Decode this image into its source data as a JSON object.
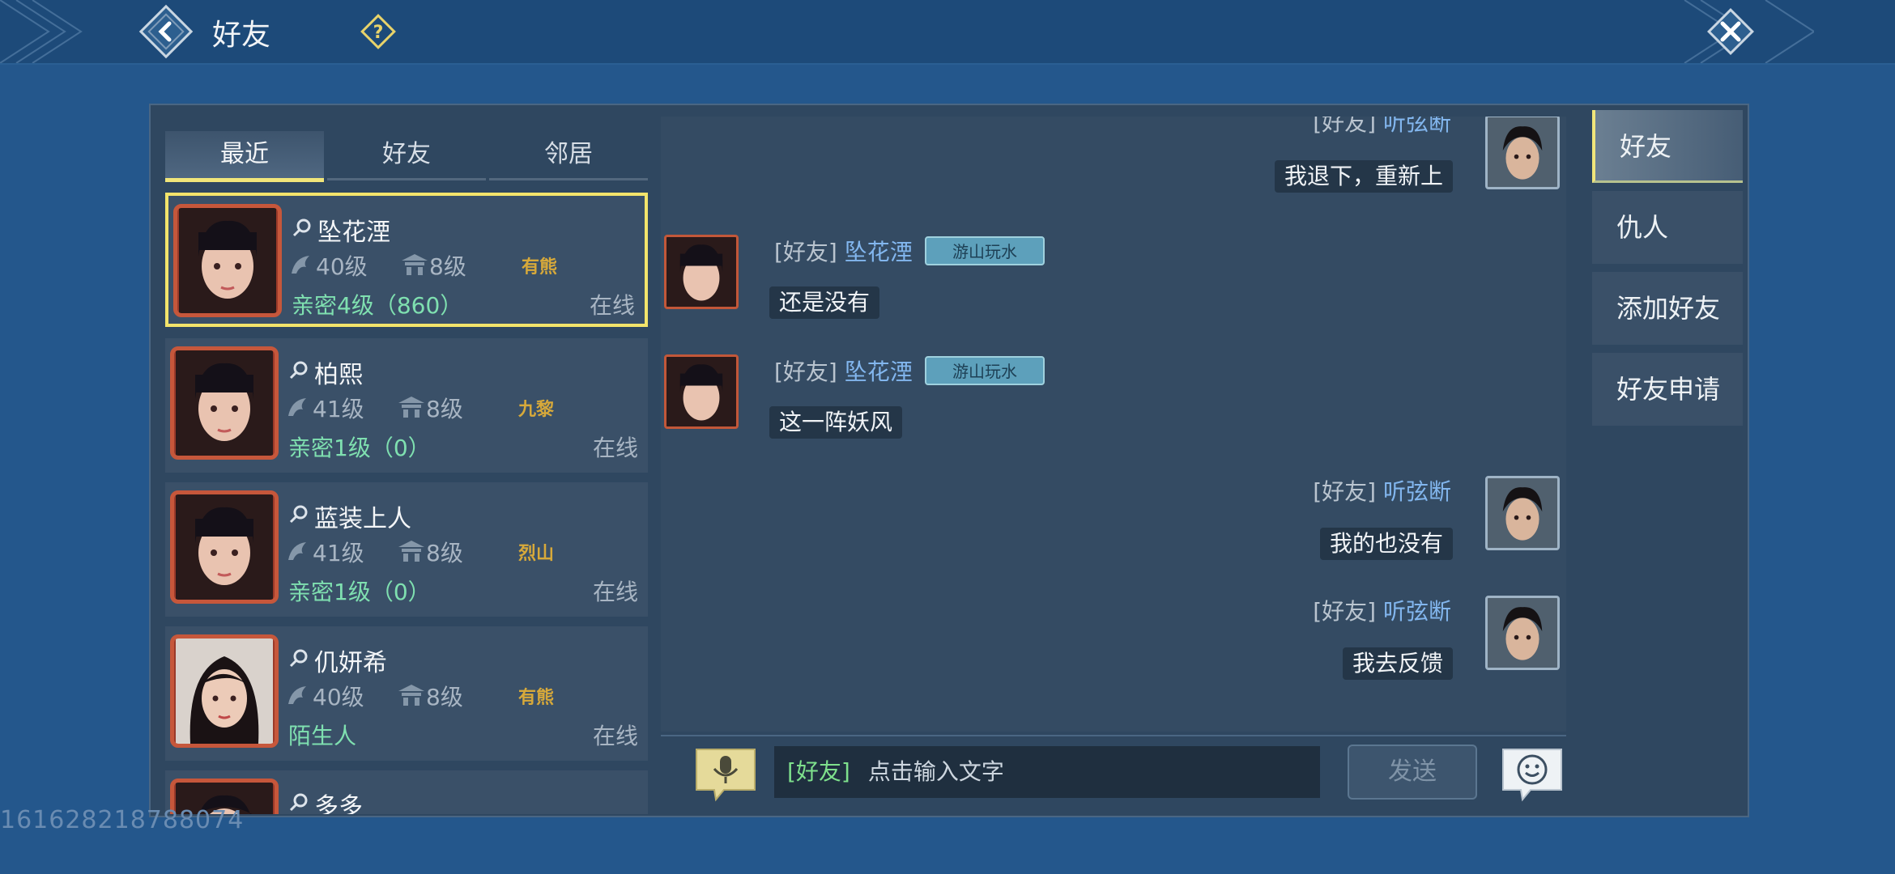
{
  "header": {
    "title": "好友"
  },
  "tabs": [
    {
      "label": "最近",
      "active": true
    },
    {
      "label": "好友",
      "active": false
    },
    {
      "label": "邻居",
      "active": false
    }
  ],
  "contacts": [
    {
      "name": "坠花湮",
      "level": "40级",
      "guild_level": "8级",
      "badge": "有熊",
      "intimacy": "亲密4级（860）",
      "status": "在线",
      "selected": true
    },
    {
      "name": "柏熙",
      "level": "41级",
      "guild_level": "8级",
      "badge": "九黎",
      "intimacy": "亲密1级（0）",
      "status": "在线",
      "selected": false
    },
    {
      "name": "蓝装上人",
      "level": "41级",
      "guild_level": "8级",
      "badge": "烈山",
      "intimacy": "亲密1级（0）",
      "status": "在线",
      "selected": false
    },
    {
      "name": "仉妍希",
      "level": "40级",
      "guild_level": "8级",
      "badge": "有熊",
      "intimacy": "陌生人",
      "status": "在线",
      "selected": false
    },
    {
      "name": "多多",
      "partial": true
    }
  ],
  "messages": [
    {
      "side": "right",
      "channel": "[好友]",
      "sender": "听弦断",
      "text": "我退下，重新上"
    },
    {
      "side": "left",
      "channel": "[好友]",
      "sender": "坠花湮",
      "title_badge": "游山玩水",
      "text": "还是没有"
    },
    {
      "side": "left",
      "channel": "[好友]",
      "sender": "坠花湮",
      "title_badge": "游山玩水",
      "text": "这一阵妖风"
    },
    {
      "side": "right",
      "channel": "[好友]",
      "sender": "听弦断",
      "text": "我的也没有"
    },
    {
      "side": "right",
      "channel": "[好友]",
      "sender": "听弦断",
      "text": "我去反馈"
    }
  ],
  "input": {
    "channel": "[好友]",
    "placeholder": "点击输入文字",
    "send_label": "发送"
  },
  "side_tabs": [
    {
      "label": "好友",
      "active": true
    },
    {
      "label": "仇人",
      "active": false
    },
    {
      "label": "添加好友",
      "active": false
    },
    {
      "label": "好友申请",
      "active": false
    }
  ],
  "watermark": "161628218788074",
  "colors": {
    "background": "#24578c",
    "panel": "#2f4760",
    "selected_border": "#f3e46b",
    "name_link": "#82b6ee",
    "intimacy_text": "#7fe0b0",
    "channel_text": "#7ee08c"
  },
  "icons": [
    "back-icon",
    "help-icon",
    "close-icon",
    "search-icon",
    "level-icon",
    "guild-icon",
    "voice-icon",
    "emoji-icon"
  ]
}
